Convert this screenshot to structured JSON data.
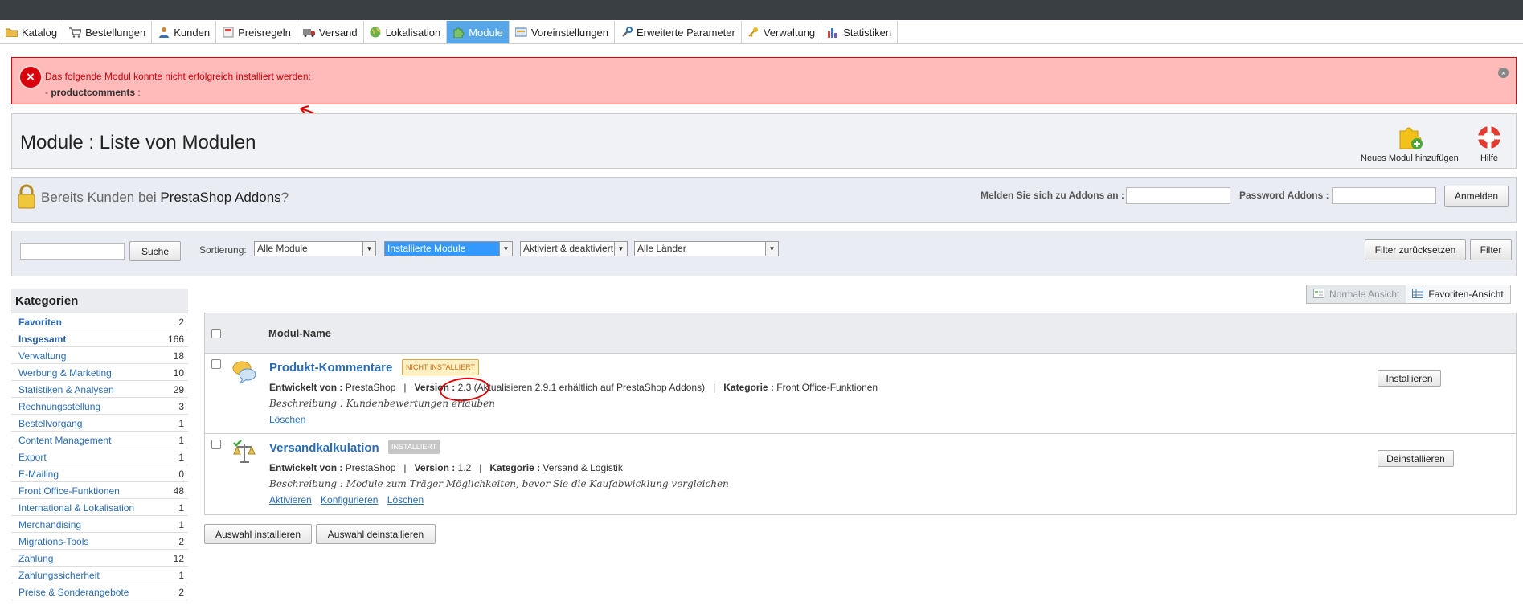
{
  "tabs": [
    {
      "label": "Katalog",
      "icon": "folder-icon"
    },
    {
      "label": "Bestellungen",
      "icon": "cart-icon"
    },
    {
      "label": "Kunden",
      "icon": "user-icon"
    },
    {
      "label": "Preisregeln",
      "icon": "price-rule-icon"
    },
    {
      "label": "Versand",
      "icon": "truck-icon"
    },
    {
      "label": "Lokalisation",
      "icon": "globe-icon"
    },
    {
      "label": "Module",
      "icon": "puzzle-icon",
      "active": true
    },
    {
      "label": "Voreinstellungen",
      "icon": "preferences-icon"
    },
    {
      "label": "Erweiterte Parameter",
      "icon": "wrench-icon"
    },
    {
      "label": "Verwaltung",
      "icon": "key-icon"
    },
    {
      "label": "Statistiken",
      "icon": "bar-chart-icon"
    }
  ],
  "error": {
    "message": "Das folgende Modul konnte nicht erfolgreich installiert werden:",
    "prefix": "- ",
    "module": "productcomments",
    "suffix": " :"
  },
  "header": {
    "title": "Module : Liste von Modulen",
    "add_module": "Neues Modul hinzufügen",
    "help": "Hilfe"
  },
  "addons": {
    "text_before": "Bereits Kunden bei ",
    "brand": "PrestaShop Addons",
    "text_after": "?",
    "login_label": "Melden Sie sich zu Addons an :",
    "login_value": "",
    "password_label": "Password Addons :",
    "password_value": "",
    "login_button": "Anmelden"
  },
  "filters": {
    "search_value": "",
    "search_button": "Suche",
    "sort_label": "Sortierung:",
    "select_all": "Alle Module",
    "select_installed": "Installierte Module",
    "select_status": "Aktiviert & deaktiviert",
    "select_country": "Alle Länder",
    "reset_button": "Filter zurücksetzen",
    "filter_button": "Filter"
  },
  "categories": {
    "title": "Kategorien",
    "items": [
      {
        "name": "Favoriten",
        "count": "2"
      },
      {
        "name": "Insgesamt",
        "count": "166"
      },
      {
        "name": "Verwaltung",
        "count": "18"
      },
      {
        "name": "Werbung & Marketing",
        "count": "10"
      },
      {
        "name": "Statistiken & Analysen",
        "count": "29"
      },
      {
        "name": "Rechnungsstellung",
        "count": "3"
      },
      {
        "name": "Bestellvorgang",
        "count": "1"
      },
      {
        "name": "Content Management",
        "count": "1"
      },
      {
        "name": "Export",
        "count": "1"
      },
      {
        "name": "E-Mailing",
        "count": "0"
      },
      {
        "name": "Front Office-Funktionen",
        "count": "48"
      },
      {
        "name": "International & Lokalisation",
        "count": "1"
      },
      {
        "name": "Merchandising",
        "count": "1"
      },
      {
        "name": "Migrations-Tools",
        "count": "2"
      },
      {
        "name": "Zahlung",
        "count": "12"
      },
      {
        "name": "Zahlungssicherheit",
        "count": "1"
      },
      {
        "name": "Preise & Sonderangebote",
        "count": "2"
      }
    ]
  },
  "view": {
    "normal": "Normale Ansicht",
    "favorites": "Favoriten-Ansicht"
  },
  "table": {
    "column": "Modul-Name",
    "modules": [
      {
        "name": "Produkt-Kommentare",
        "status": "NICHT INSTALLIERT",
        "dev_label": "Entwickelt von :",
        "dev": "PrestaShop",
        "version_label": "Version :",
        "version": "2.3 (Aktualisieren 2.9.1 erhältlich auf PrestaShop Addons)",
        "category_label": "Kategorie :",
        "category": "Front Office-Funktionen",
        "description": "Beschreibung : Kundenbewertungen erlauben",
        "links": [
          "Löschen"
        ],
        "action": "Installieren"
      },
      {
        "name": "Versandkalkulation",
        "status": "INSTALLIERT",
        "dev_label": "Entwickelt von :",
        "dev": "PrestaShop",
        "version_label": "Version :",
        "version": "1.2",
        "category_label": "Kategorie :",
        "category": "Versand & Logistik",
        "description": "Beschreibung : Module zum Träger Möglichkeiten, bevor Sie die Kaufabwicklung vergleichen",
        "links": [
          "Aktivieren",
          "Konfigurieren",
          "Löschen"
        ],
        "action": "Deinstallieren"
      }
    ],
    "bulk_install": "Auswahl installieren",
    "bulk_uninstall": "Auswahl deinstallieren"
  },
  "colors": {
    "error_bg": "#ffbaba",
    "error_text": "#d8000c",
    "active_tab": "#57a7e8",
    "link": "#2a6db5",
    "annotation": "#e00000"
  }
}
